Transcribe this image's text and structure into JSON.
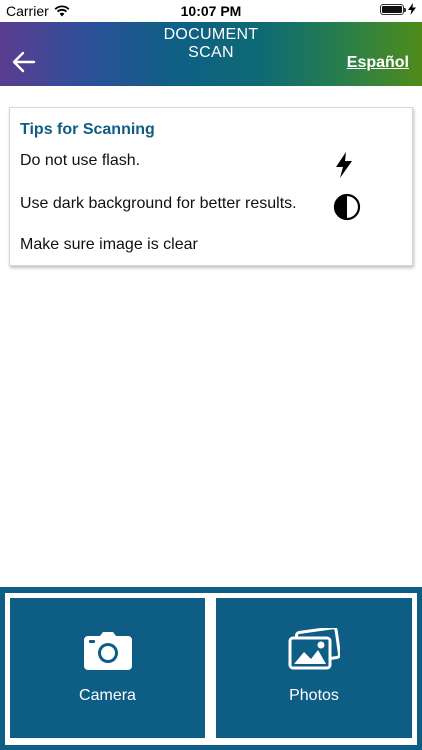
{
  "status_bar": {
    "carrier": "Carrier",
    "time": "10:07 PM"
  },
  "header": {
    "title_line1": "DOCUMENT",
    "title_line2": "SCAN",
    "language_link": "Español"
  },
  "tips": {
    "title": "Tips for Scanning",
    "items": [
      {
        "text": "Do not use flash.",
        "icon": "flash-icon"
      },
      {
        "text": "Use dark background for better results.",
        "icon": "contrast-icon"
      },
      {
        "text": "Make sure image is clear",
        "icon": ""
      }
    ]
  },
  "actions": {
    "camera_label": "Camera",
    "photos_label": "Photos"
  },
  "colors": {
    "brand_blue": "#0e5d84",
    "header_gradient_start": "#5b3d8f",
    "header_gradient_end": "#4f8b1a"
  }
}
